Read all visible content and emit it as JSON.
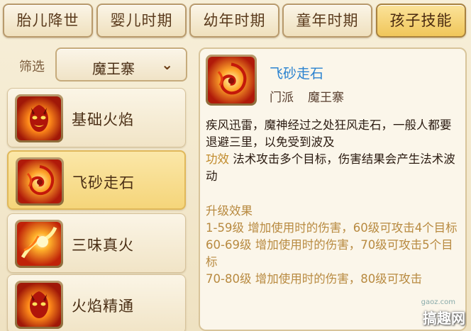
{
  "tabs": [
    {
      "label": "胎儿降世",
      "active": false
    },
    {
      "label": "婴儿时期",
      "active": false
    },
    {
      "label": "幼年时期",
      "active": false
    },
    {
      "label": "童年时期",
      "active": false
    },
    {
      "label": "孩子技能",
      "active": true
    }
  ],
  "filter": {
    "label": "筛选",
    "value": "魔王寨"
  },
  "skills": [
    {
      "label": "基础火焰",
      "icon": "demon-flame-icon",
      "selected": false
    },
    {
      "label": "飞砂走石",
      "icon": "fire-swirl-icon",
      "selected": true
    },
    {
      "label": "三味真火",
      "icon": "fireball-icon",
      "selected": false
    },
    {
      "label": "火焰精通",
      "icon": "demon-flame-icon",
      "selected": false
    }
  ],
  "detail": {
    "name": "飞砂走石",
    "sect_label": "门派",
    "sect_value": "魔王寨",
    "description": "疾风迅雷，魔神经过之处狂风走石，一般人都要退避三里，以免受到波及",
    "effect_label": "功效",
    "effect_text": "法术攻击多个目标，伤害结果会产生法术波动",
    "upgrade_title": "升级效果",
    "upgrades": [
      "1-59级 增加使用时的伤害，60级可攻击4个目标",
      "60-69级 增加使用时的伤害，70级可攻击5个目标",
      "70-80级 增加使用时的伤害，80级可攻击"
    ]
  },
  "watermark": {
    "site": "搞趣网",
    "url": "gaoz.com"
  },
  "colors": {
    "accent_tab": "#f0c65a",
    "skill_name": "#2a82d0",
    "keyword": "#c08a2a"
  }
}
